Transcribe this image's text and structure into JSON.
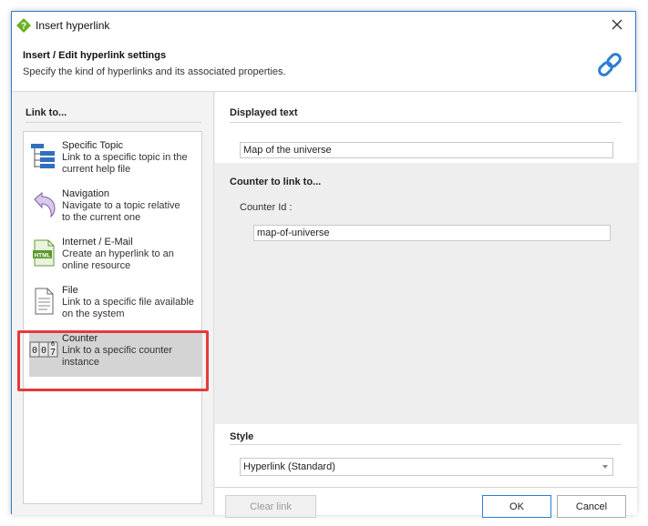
{
  "window": {
    "title": "Insert hyperlink",
    "app_icon": "help-diamond-icon",
    "close_icon": "close-icon"
  },
  "header": {
    "title": "Insert / Edit hyperlink settings",
    "subtitle": "Specify the kind of hyperlinks and its associated properties.",
    "icon": "chain-link-icon"
  },
  "left": {
    "section_title": "Link to...",
    "items": [
      {
        "name": "Specific Topic",
        "desc1": "Link to a specific topic in the",
        "desc2": "current help file",
        "icon": "topic-tree-icon"
      },
      {
        "name": "Navigation",
        "desc1": "Navigate to a topic relative",
        "desc2": "to the current one",
        "icon": "navigation-arrow-icon"
      },
      {
        "name": "Internet / E-Mail",
        "desc1": "Create an hyperlink to an",
        "desc2": "online resource",
        "icon": "html-file-icon"
      },
      {
        "name": "File",
        "desc1": "Link to a specific file available",
        "desc2": "on the system",
        "icon": "file-icon"
      },
      {
        "name": "Counter",
        "desc1": "Link to a specific counter",
        "desc2": "instance",
        "icon": "counter-icon",
        "selected": true
      }
    ]
  },
  "right": {
    "displayed_text": {
      "title": "Displayed text",
      "value": "Map of the universe"
    },
    "counter": {
      "title": "Counter to link to...",
      "id_label": "Counter Id :",
      "id_value": "map-of-universe"
    },
    "style": {
      "title": "Style",
      "selected": "Hyperlink (Standard)"
    }
  },
  "footer": {
    "clear_label": "Clear link",
    "ok_label": "OK",
    "cancel_label": "Cancel"
  },
  "colors": {
    "accent": "#2b7fd6",
    "highlight": "#e53a3a"
  }
}
